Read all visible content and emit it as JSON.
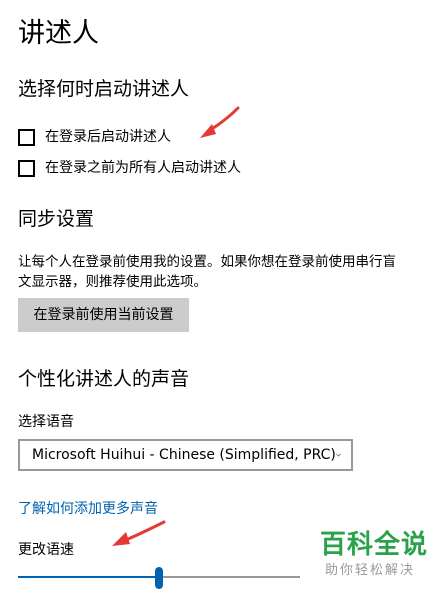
{
  "page": {
    "title": "讲述人"
  },
  "startup": {
    "heading": "选择何时启动讲述人",
    "options": [
      {
        "label": "在登录后启动讲述人",
        "checked": false
      },
      {
        "label": "在登录之前为所有人启动讲述人",
        "checked": false
      }
    ]
  },
  "sync": {
    "heading": "同步设置",
    "description_lines": [
      "让每个人在登录前使用我的设置。如果你想在登录前使用串行盲",
      "文显示器，则推荐使用此选项。"
    ],
    "button_label": "在登录前使用当前设置"
  },
  "voice": {
    "heading": "个性化讲述人的声音",
    "select_label": "选择语音",
    "selected_voice": "Microsoft Huihui - Chinese (Simplified, PRC)",
    "add_voices_link": "了解如何添加更多声音",
    "speed_label": "更改语速",
    "speed_value": 0.5
  },
  "watermark": {
    "title": "百科全说",
    "subtitle": "助你轻松解决"
  },
  "colors": {
    "accent": "#0063b1",
    "annotation": "#e53935",
    "watermark_green": "#2aa24a"
  }
}
